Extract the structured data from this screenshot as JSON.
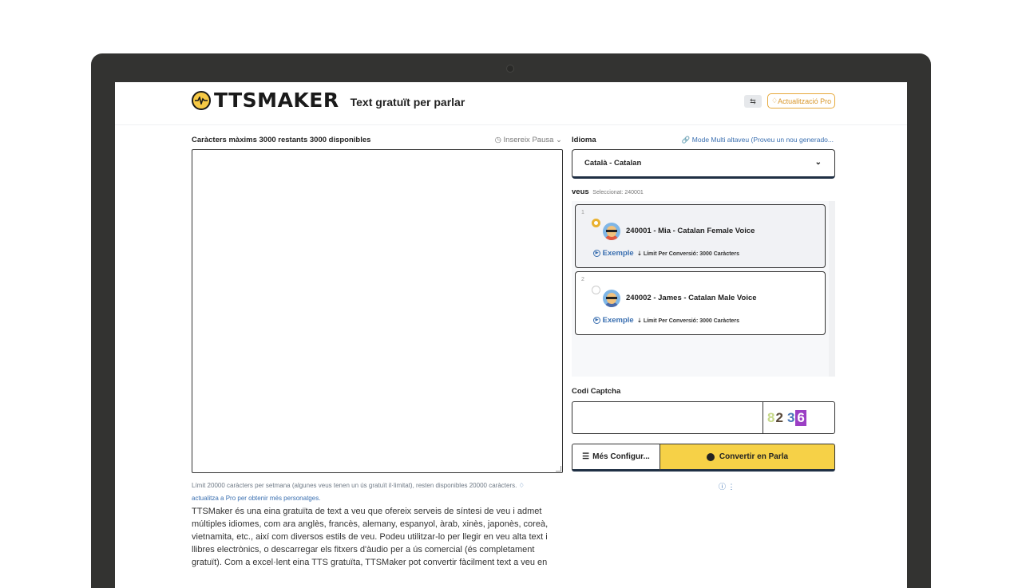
{
  "header": {
    "brand": "TTSMAKER",
    "tagline": "Text gratuït per parlar",
    "lang_icon": "translate-icon",
    "pro_label": "Actualització Pro"
  },
  "editor": {
    "max_chars": "Caràcters màxims 3000 restants 3000 disponibles",
    "pause_label": "Insereix Pausa",
    "text_value": "",
    "limit_note": "Límit 20000 caràcters per setmana (algunes veus tenen un ús gratuït il·limitat), resten disponibles 20000 caràcters.",
    "upgrade_link": "actualitza a Pro per obtenir més personatges.",
    "description": "TTSMaker és una eina gratuïta de text a veu que ofereix serveis de síntesi de veu i admet múltiples idiomes, com ara anglès, francès, alemany, espanyol, àrab, xinès, japonès, coreà, vietnamita, etc., així com diversos estils de veu. Podeu utilitzar-lo per llegir en veu alta text i llibres electrònics, o descarregar els fitxers d'àudio per a ús comercial (és completament gratuït). Com a excel·lent eina TTS gratuïta, TTSMaker pot convertir fàcilment text a veu en"
  },
  "language": {
    "label": "Idioma",
    "multi_link": "Mode Multi altaveu (Proveu un nou generado...",
    "selected": "Català - Catalan"
  },
  "voices": {
    "label": "veus",
    "selected_note": "Seleccionat: 240001",
    "items": [
      {
        "num": "1",
        "name": "240001 - Mia - Catalan Female Voice",
        "sample": "Exemple",
        "limit": "Límit Per Conversió: 3000 Caràcters"
      },
      {
        "num": "2",
        "name": "240002 - James - Catalan Male Voice",
        "sample": "Exemple",
        "limit": "Límit Per Conversió: 3000 Caràcters"
      }
    ]
  },
  "captcha": {
    "label": "Codi Captcha",
    "value": "",
    "digits": [
      "8",
      "2",
      "3",
      "6"
    ]
  },
  "actions": {
    "config_label": "Més Configur...",
    "convert_label": "Convertir en Parla"
  },
  "colors": {
    "accent": "#f6d147",
    "link": "#3a6fb0",
    "pro": "#d8962a"
  }
}
